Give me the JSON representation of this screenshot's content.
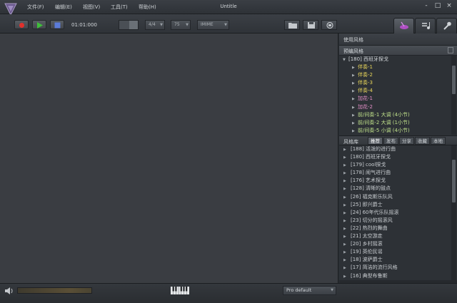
{
  "window": {
    "title": "Untitle"
  },
  "menu": [
    "文件(F)",
    "编辑(E)",
    "视图(V)",
    "工具(T)",
    "帮助(H)"
  ],
  "window_controls": [
    "-",
    "□",
    "×"
  ],
  "transport": {
    "time": "01:01:000"
  },
  "toolbar": {
    "time_signature": "4/4",
    "tempo": "75",
    "input_mode": "IMIME"
  },
  "colors": {
    "record": "#e2302c",
    "play": "#3fbf3a",
    "stop": "#5b7bd8",
    "yellow_item": "#e8d55a",
    "pink_item": "#e58fc8",
    "green_item": "#bfe08a"
  },
  "right_panel": {
    "title": "使用风格",
    "preset_header": "预编风格",
    "preset_group": "[180] 西班牙探戈",
    "preset_items": [
      {
        "label": "伴奏-1",
        "color": "yellow"
      },
      {
        "label": "伴奏-2",
        "color": "yellow"
      },
      {
        "label": "伴奏-3",
        "color": "yellow"
      },
      {
        "label": "伴奏-4",
        "color": "yellow"
      },
      {
        "label": "加花-1",
        "color": "pink"
      },
      {
        "label": "加花-2",
        "color": "pink"
      },
      {
        "label": "前/间奏-1 大调 (4小节)",
        "color": "green"
      },
      {
        "label": "前/间奏-2 大调 (1小节)",
        "color": "green"
      },
      {
        "label": "前/间奏-5 小调 (4小节)",
        "color": "green"
      }
    ],
    "library_title": "风格库",
    "library_tabs": [
      "推荐",
      "发布",
      "分享",
      "收藏",
      "本地"
    ],
    "library_active_tab": "推荐",
    "library_items": [
      "[188] 活泼的进行曲",
      "[180] 西班牙探戈",
      "[179] cool探戈",
      "[178] 闹气进行曲",
      "[176] 艺术探戈",
      "[128] 清晰的鼓点",
      "[26] 福克斯乐队风",
      "[25] 即兴爵士",
      "[24] 60年代乐队摇滚",
      "[23] 切分的摇滚风",
      "[22] 热烈的舞曲",
      "[21] 太空游走",
      "[20] 乡村摇滚",
      "[19] 英伦民谣",
      "[18] 波萨爵士",
      "[17] 简洁的流行风格",
      "[16] 典型布鲁斯"
    ]
  },
  "statusbar": {
    "preset_select": "Pro default"
  }
}
